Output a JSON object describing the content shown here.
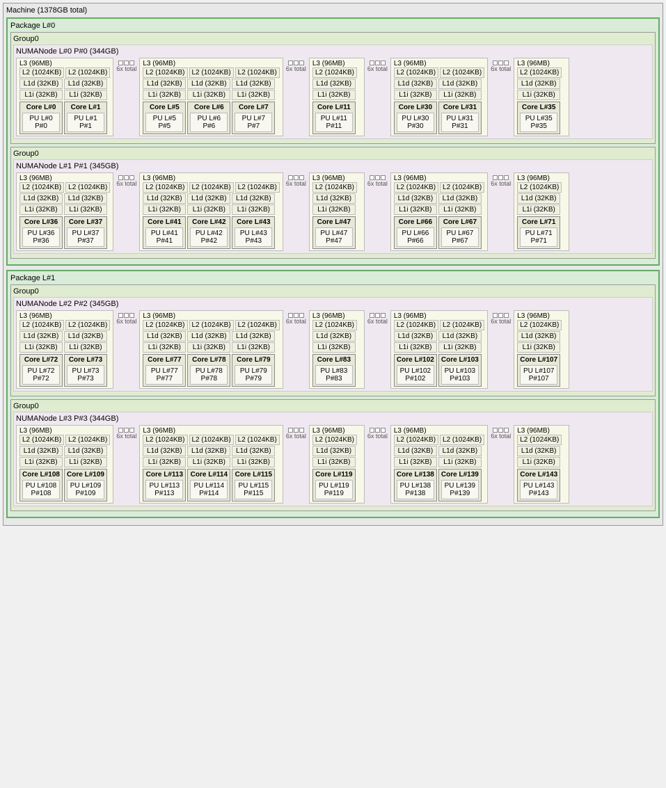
{
  "machine": {
    "title": "Machine (1378GB total)",
    "packages": [
      {
        "label": "Package L#0",
        "groups": [
          {
            "label": "Group0",
            "numa": {
              "label": "NUMANode L#0 P#0 (344GB)",
              "l3_sections": [
                {
                  "l3_blocks": [
                    {
                      "label": "L3 (96MB)",
                      "span": 2,
                      "l2_pairs": [
                        {
                          "a": "L2 (1024KB)",
                          "b": "L2 (1024KB)"
                        },
                        {
                          "a": "L1d (32KB)",
                          "b": "L1d (32KB)"
                        },
                        {
                          "a": "L1i (32KB)",
                          "b": "L1i (32KB)"
                        }
                      ],
                      "cores": [
                        {
                          "label": "Core L#0",
                          "pu": "PU L#0\nP#0"
                        },
                        {
                          "label": "Core L#1",
                          "pu": "PU L#1\nP#1"
                        }
                      ]
                    }
                  ],
                  "extra": {
                    "dots": 3,
                    "label": "6x total"
                  }
                },
                {
                  "l3_blocks": [
                    {
                      "label": "L3 (96MB)",
                      "span": 3,
                      "l2_pairs": [
                        {
                          "a": "L2 (1024KB)",
                          "b": "L2 (1024KB)",
                          "c": "L2 (1024KB)"
                        },
                        {
                          "a": "L1d (32KB)",
                          "b": "L1d (32KB)",
                          "c": "L1d (32KB)"
                        },
                        {
                          "a": "L1i (32KB)",
                          "b": "L1i (32KB)",
                          "c": "L1i (32KB)"
                        }
                      ],
                      "cores": [
                        {
                          "label": "Core L#5",
                          "pu": "PU L#5\nP#5"
                        },
                        {
                          "label": "Core L#6",
                          "pu": "PU L#6\nP#6"
                        },
                        {
                          "label": "Core L#7",
                          "pu": "PU L#7\nP#7"
                        }
                      ]
                    }
                  ],
                  "extra": {
                    "dots": 3,
                    "label": "6x total"
                  }
                },
                {
                  "l3_blocks": [
                    {
                      "label": "L3 (96MB)",
                      "span": 1,
                      "l2_pairs": [
                        {
                          "a": "L2 (1024KB)"
                        },
                        {
                          "a": "L1d (32KB)"
                        },
                        {
                          "a": "L1i (32KB)"
                        }
                      ],
                      "cores": [
                        {
                          "label": "Core L#11",
                          "pu": "PU L#11\nP#11"
                        }
                      ]
                    }
                  ],
                  "extra": null
                }
              ]
            }
          }
        ]
      }
    ]
  }
}
